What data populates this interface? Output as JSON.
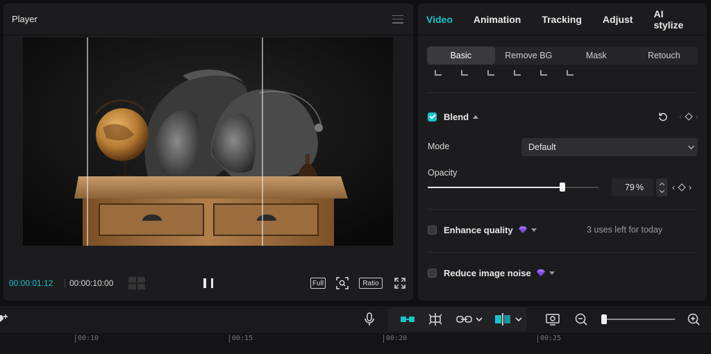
{
  "player": {
    "title": "Player",
    "current_time": "00:00:01:12",
    "total_time": "00:00:10:00",
    "full_label": "Full",
    "ratio_label": "Ratio"
  },
  "panel": {
    "tabs": [
      {
        "label": "Video",
        "active": true
      },
      {
        "label": "Animation",
        "active": false
      },
      {
        "label": "Tracking",
        "active": false
      },
      {
        "label": "Adjust",
        "active": false
      },
      {
        "label": "AI stylize",
        "active": false
      }
    ],
    "subtabs": [
      {
        "label": "Basic",
        "active": true
      },
      {
        "label": "Remove BG",
        "active": false
      },
      {
        "label": "Mask",
        "active": false
      },
      {
        "label": "Retouch",
        "active": false
      }
    ],
    "blend": {
      "label": "Blend",
      "checked": true,
      "mode_label": "Mode",
      "mode_value": "Default",
      "opacity_label": "Opacity",
      "opacity_value": "79",
      "opacity_unit": "%",
      "opacity_fraction": 0.79
    },
    "enhance": {
      "label": "Enhance quality",
      "checked": false,
      "uses_left": "3 uses left for today"
    },
    "noise": {
      "label": "Reduce image noise",
      "checked": false
    }
  },
  "colors": {
    "accent": "#19c3c9",
    "premium_gem": "#9b6bff"
  },
  "timeline": {
    "ticks": [
      "00:10",
      "00:15",
      "00:20",
      "00:25"
    ]
  }
}
